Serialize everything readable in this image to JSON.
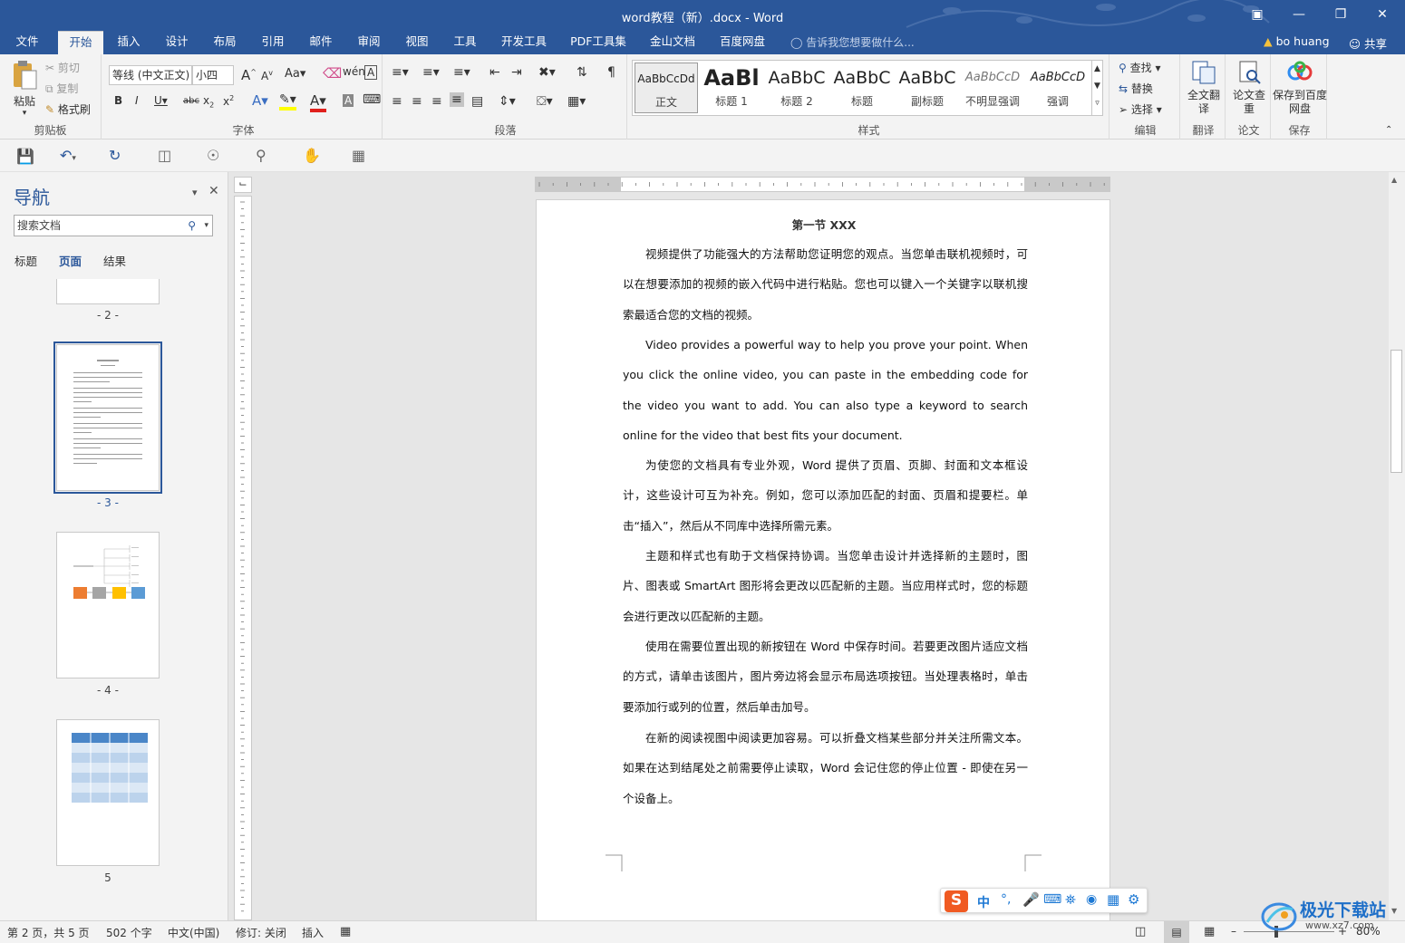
{
  "window": {
    "title": "word教程（新）.docx - Word"
  },
  "menu": {
    "tabs": [
      "文件",
      "开始",
      "插入",
      "设计",
      "布局",
      "引用",
      "邮件",
      "审阅",
      "视图",
      "工具",
      "开发工具",
      "PDF工具集",
      "金山文档",
      "百度网盘"
    ],
    "active_tab": "开始",
    "tell_me": "告诉我您想要做什么...",
    "user": "bo huang",
    "share": "共享"
  },
  "ribbon": {
    "clipboard": {
      "paste": "粘贴",
      "cut": "剪切",
      "copy": "复制",
      "format_painter": "格式刷",
      "label": "剪贴板"
    },
    "font": {
      "name": "等线 (中文正文)",
      "size": "小四",
      "case": "Aa",
      "label": "字体"
    },
    "paragraph": {
      "label": "段落"
    },
    "styles": {
      "items": [
        {
          "preview": "AaBbCcDd",
          "name": "正文"
        },
        {
          "preview": "AaBl",
          "name": "标题 1"
        },
        {
          "preview": "AaBbC",
          "name": "标题 2"
        },
        {
          "preview": "AaBbC",
          "name": "标题"
        },
        {
          "preview": "AaBbC",
          "name": "副标题"
        },
        {
          "preview": "AaBbCcD",
          "name": "不明显强调"
        },
        {
          "preview": "AaBbCcD",
          "name": "强调"
        }
      ],
      "label": "样式"
    },
    "editing": {
      "find": "查找",
      "replace": "替换",
      "select": "选择",
      "label": "编辑"
    },
    "translate": {
      "btn": "全文翻译",
      "label": "翻译"
    },
    "paper": {
      "btn": "论文查重",
      "label": "论文"
    },
    "save": {
      "btn": "保存到百度网盘",
      "label": "保存"
    }
  },
  "nav": {
    "title": "导航",
    "search_placeholder": "搜索文档",
    "tabs": [
      "标题",
      "页面",
      "结果"
    ],
    "active_tab": "页面",
    "pages": [
      "- 2 -",
      "- 3 -",
      "- 4 -",
      "5"
    ]
  },
  "document": {
    "heading": "第一节 XXX",
    "paragraphs": [
      "视频提供了功能强大的方法帮助您证明您的观点。当您单击联机视频时，可以在想要添加的视频的嵌入代码中进行粘贴。您也可以键入一个关键字以联机搜索最适合您的文档的视频。",
      "Video provides a powerful way to help you prove your point. When you click the online video, you can paste in the embedding code for the video you want to add. You can also type a keyword to search online for the video that best fits your document.",
      "为使您的文档具有专业外观，Word 提供了页眉、页脚、封面和文本框设计，这些设计可互为补充。例如，您可以添加匹配的封面、页眉和提要栏。单击“插入”，然后从不同库中选择所需元素。",
      "主题和样式也有助于文档保持协调。当您单击设计并选择新的主题时，图片、图表或 SmartArt 图形将会更改以匹配新的主题。当应用样式时，您的标题会进行更改以匹配新的主题。",
      "使用在需要位置出现的新按钮在 Word 中保存时间。若要更改图片适应文档的方式，请单击该图片，图片旁边将会显示布局选项按钮。当处理表格时，单击要添加行或列的位置，然后单击加号。",
      "在新的阅读视图中阅读更加容易。可以折叠文档某些部分并关注所需文本。如果在达到结尾处之前需要停止读取，Word 会记住您的停止位置 - 即使在另一个设备上。"
    ]
  },
  "status": {
    "page": "第 2 页，共 5 页",
    "words": "502 个字",
    "lang": "中文(中国)",
    "track": "修订: 关闭",
    "mode": "插入",
    "zoom": "80%"
  },
  "ime": {
    "label": "中"
  },
  "watermark": {
    "text": "极光下载站",
    "url": "www.xz7.com"
  },
  "colors": {
    "accent": "#2b579a",
    "ime_orange": "#f05a22",
    "ime_blue": "#1c78d4"
  }
}
